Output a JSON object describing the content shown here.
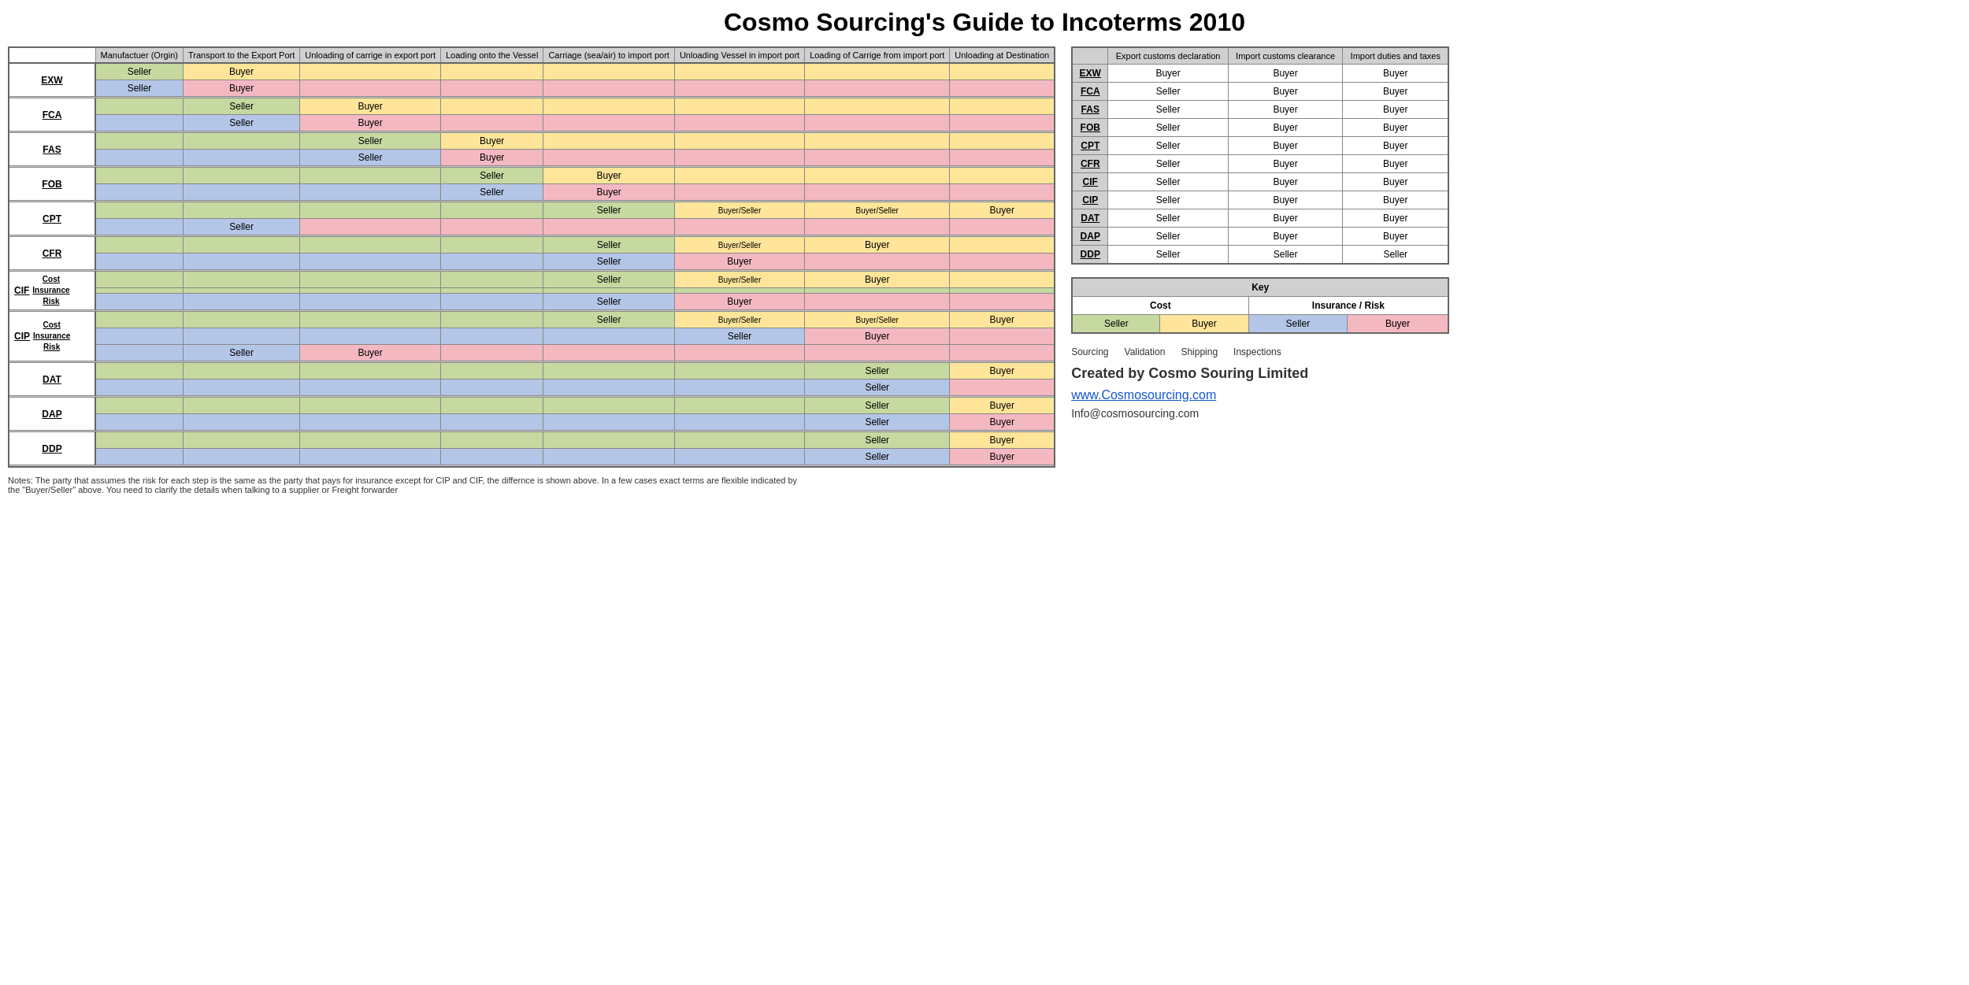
{
  "title": "Cosmo Sourcing's Guide to Incoterms 2010",
  "mainTable": {
    "headers": [
      "",
      "Manufactuer (Orgin)",
      "Transport to the Export Port",
      "Unloading of carrige in export port",
      "Loading onto the Vessel",
      "Carriage (sea/air) to import port",
      "Unloading Vessel in import port",
      "Loading of Carrige from import port",
      "Unloading at Destination"
    ],
    "rows": [
      {
        "term": "EXW",
        "rows": [
          [
            "Seller",
            "Buyer",
            "",
            "",
            "",
            "",
            "",
            ""
          ],
          [
            "Seller",
            "Buyer",
            "",
            "",
            "",
            "",
            "",
            ""
          ]
        ],
        "rowColors": [
          [
            "green-seller",
            "yellow-buyer",
            "yellow-buyer",
            "yellow-buyer",
            "yellow-buyer",
            "yellow-buyer",
            "yellow-buyer",
            "yellow-buyer"
          ],
          [
            "blue-seller",
            "pink-buyer",
            "pink-buyer",
            "pink-buyer",
            "pink-buyer",
            "pink-buyer",
            "pink-buyer",
            "pink-buyer"
          ]
        ]
      },
      {
        "term": "FCA",
        "rows": [
          [
            "",
            "Seller",
            "Buyer",
            "",
            "",
            "",
            "",
            ""
          ],
          [
            "",
            "Seller",
            "Buyer",
            "",
            "",
            "",
            "",
            ""
          ]
        ],
        "rowColors": [
          [
            "green-seller",
            "green-seller",
            "yellow-buyer",
            "yellow-buyer",
            "yellow-buyer",
            "yellow-buyer",
            "yellow-buyer",
            "yellow-buyer"
          ],
          [
            "blue-seller",
            "blue-seller",
            "pink-buyer",
            "pink-buyer",
            "pink-buyer",
            "pink-buyer",
            "pink-buyer",
            "pink-buyer"
          ]
        ]
      },
      {
        "term": "FAS",
        "rows": [
          [
            "",
            "",
            "Seller",
            "Buyer",
            "",
            "",
            "",
            ""
          ],
          [
            "",
            "",
            "Seller",
            "Buyer",
            "",
            "",
            "",
            ""
          ]
        ],
        "rowColors": [
          [
            "green-seller",
            "green-seller",
            "green-seller",
            "yellow-buyer",
            "yellow-buyer",
            "yellow-buyer",
            "yellow-buyer",
            "yellow-buyer"
          ],
          [
            "blue-seller",
            "blue-seller",
            "blue-seller",
            "pink-buyer",
            "pink-buyer",
            "pink-buyer",
            "pink-buyer",
            "pink-buyer"
          ]
        ]
      },
      {
        "term": "FOB",
        "rows": [
          [
            "",
            "",
            "",
            "Seller",
            "Buyer",
            "",
            "",
            ""
          ],
          [
            "",
            "",
            "",
            "Seller",
            "Buyer",
            "",
            "",
            ""
          ]
        ],
        "rowColors": [
          [
            "green-seller",
            "green-seller",
            "green-seller",
            "green-seller",
            "yellow-buyer",
            "yellow-buyer",
            "yellow-buyer",
            "yellow-buyer"
          ],
          [
            "blue-seller",
            "blue-seller",
            "blue-seller",
            "blue-seller",
            "pink-buyer",
            "pink-buyer",
            "pink-buyer",
            "pink-buyer"
          ]
        ]
      },
      {
        "term": "CPT",
        "rows": [
          [
            "",
            "",
            "",
            "",
            "Seller",
            "Buyer/Seller",
            "Buyer/Seller",
            "Buyer"
          ],
          [
            "",
            "Seller",
            "",
            "",
            "",
            "",
            "",
            ""
          ]
        ],
        "rowColors": [
          [
            "green-seller",
            "green-seller",
            "green-seller",
            "green-seller",
            "green-seller",
            "yellow-buyer",
            "yellow-buyer",
            "yellow-buyer"
          ],
          [
            "blue-seller",
            "blue-seller",
            "pink-buyer",
            "pink-buyer",
            "pink-buyer",
            "pink-buyer",
            "pink-buyer",
            "pink-buyer"
          ]
        ]
      },
      {
        "term": "CFR",
        "rows": [
          [
            "",
            "",
            "",
            "",
            "Seller",
            "Buyer/Seller",
            "Buyer",
            ""
          ],
          [
            "",
            "",
            "",
            "",
            "Seller",
            "Buyer",
            "",
            ""
          ]
        ],
        "rowColors": [
          [
            "green-seller",
            "green-seller",
            "green-seller",
            "green-seller",
            "green-seller",
            "yellow-buyer",
            "yellow-buyer",
            "yellow-buyer"
          ],
          [
            "blue-seller",
            "blue-seller",
            "blue-seller",
            "blue-seller",
            "blue-seller",
            "pink-buyer",
            "pink-buyer",
            "pink-buyer"
          ]
        ]
      },
      {
        "term": "CIF",
        "label_rows": [
          "Cost",
          "Insurance",
          "Risk"
        ],
        "rows": [
          [
            "",
            "",
            "",
            "",
            "Seller",
            "Buyer/Seller",
            "Buyer",
            ""
          ],
          [
            "",
            "",
            "",
            "",
            "",
            "",
            "",
            ""
          ],
          [
            "",
            "",
            "",
            "",
            "Seller",
            "Buyer",
            "",
            ""
          ]
        ],
        "rowColors": [
          [
            "green-seller",
            "green-seller",
            "green-seller",
            "green-seller",
            "green-seller",
            "yellow-buyer",
            "yellow-buyer",
            "yellow-buyer"
          ],
          [
            "green-seller",
            "green-seller",
            "green-seller",
            "green-seller",
            "green-seller",
            "green-seller",
            "green-seller",
            "green-seller"
          ],
          [
            "blue-seller",
            "blue-seller",
            "blue-seller",
            "blue-seller",
            "blue-seller",
            "pink-buyer",
            "pink-buyer",
            "pink-buyer"
          ]
        ]
      },
      {
        "term": "CIP",
        "label_rows": [
          "Cost",
          "Insurance",
          "Risk"
        ],
        "rows": [
          [
            "",
            "",
            "",
            "",
            "Seller",
            "Buyer/Seller",
            "Buyer/Seller",
            "Buyer"
          ],
          [
            "",
            "",
            "",
            "",
            "",
            "Seller",
            "Buyer",
            ""
          ],
          [
            "",
            "Seller",
            "Buyer",
            "",
            "",
            "",
            "",
            ""
          ]
        ],
        "rowColors": [
          [
            "green-seller",
            "green-seller",
            "green-seller",
            "green-seller",
            "green-seller",
            "yellow-buyer",
            "yellow-buyer",
            "yellow-buyer"
          ],
          [
            "blue-seller",
            "blue-seller",
            "blue-seller",
            "blue-seller",
            "blue-seller",
            "blue-seller",
            "pink-buyer",
            "pink-buyer"
          ],
          [
            "blue-seller",
            "blue-seller",
            "pink-buyer",
            "pink-buyer",
            "pink-buyer",
            "pink-buyer",
            "pink-buyer",
            "pink-buyer"
          ]
        ]
      },
      {
        "term": "DAT",
        "rows": [
          [
            "",
            "",
            "",
            "",
            "",
            "",
            "Seller",
            "Buyer"
          ],
          [
            "",
            "",
            "",
            "",
            "",
            "",
            "Seller",
            ""
          ]
        ],
        "rowColors": [
          [
            "green-seller",
            "green-seller",
            "green-seller",
            "green-seller",
            "green-seller",
            "green-seller",
            "green-seller",
            "yellow-buyer"
          ],
          [
            "blue-seller",
            "blue-seller",
            "blue-seller",
            "blue-seller",
            "blue-seller",
            "blue-seller",
            "blue-seller",
            "pink-buyer"
          ]
        ]
      },
      {
        "term": "DAP",
        "rows": [
          [
            "",
            "",
            "",
            "",
            "",
            "",
            "Seller",
            "Buyer"
          ],
          [
            "",
            "",
            "",
            "",
            "",
            "",
            "Seller",
            "Buyer"
          ]
        ],
        "rowColors": [
          [
            "green-seller",
            "green-seller",
            "green-seller",
            "green-seller",
            "green-seller",
            "green-seller",
            "green-seller",
            "yellow-buyer"
          ],
          [
            "blue-seller",
            "blue-seller",
            "blue-seller",
            "blue-seller",
            "blue-seller",
            "blue-seller",
            "blue-seller",
            "pink-buyer"
          ]
        ]
      },
      {
        "term": "DDP",
        "rows": [
          [
            "",
            "",
            "",
            "",
            "",
            "",
            "Seller",
            "Buyer"
          ],
          [
            "",
            "",
            "",
            "",
            "",
            "",
            "Seller",
            "Buyer"
          ]
        ],
        "rowColors": [
          [
            "green-seller",
            "green-seller",
            "green-seller",
            "green-seller",
            "green-seller",
            "green-seller",
            "green-seller",
            "yellow-buyer"
          ],
          [
            "blue-seller",
            "blue-seller",
            "blue-seller",
            "blue-seller",
            "blue-seller",
            "blue-seller",
            "blue-seller",
            "pink-buyer"
          ]
        ]
      }
    ]
  },
  "customsTable": {
    "headers": [
      "",
      "Export customs declaration",
      "Import customs clearance",
      "Import duties and taxes"
    ],
    "rows": [
      {
        "term": "EXW",
        "cols": [
          "Buyer",
          "Buyer",
          "Buyer"
        ]
      },
      {
        "term": "FCA",
        "cols": [
          "Seller",
          "Buyer",
          "Buyer"
        ]
      },
      {
        "term": "FAS",
        "cols": [
          "Seller",
          "Buyer",
          "Buyer"
        ]
      },
      {
        "term": "FOB",
        "cols": [
          "Seller",
          "Buyer",
          "Buyer"
        ]
      },
      {
        "term": "CPT",
        "cols": [
          "Seller",
          "Buyer",
          "Buyer"
        ]
      },
      {
        "term": "CFR",
        "cols": [
          "Seller",
          "Buyer",
          "Buyer"
        ]
      },
      {
        "term": "CIF",
        "cols": [
          "Seller",
          "Buyer",
          "Buyer"
        ]
      },
      {
        "term": "CIP",
        "cols": [
          "Seller",
          "Buyer",
          "Buyer"
        ]
      },
      {
        "term": "DAT",
        "cols": [
          "Seller",
          "Buyer",
          "Buyer"
        ]
      },
      {
        "term": "DAP",
        "cols": [
          "Seller",
          "Buyer",
          "Buyer"
        ]
      },
      {
        "term": "DDP",
        "cols": [
          "Seller",
          "Seller",
          "Seller"
        ]
      }
    ]
  },
  "keyTable": {
    "title": "Key",
    "costLabel": "Cost",
    "insuranceLabel": "Insurance / Risk",
    "sellerCost": "Seller",
    "buyerCost": "Buyer",
    "sellerInsurance": "Seller",
    "buyerInsurance": "Buyer"
  },
  "services": [
    "Sourcing",
    "Validation",
    "Shipping",
    "Inspections"
  ],
  "createdBy": "Created by Cosmo Souring Limited",
  "website": "www.Cosmosourcing.com",
  "email": "Info@cosmosourcing.com",
  "notes": "Notes: The party that assumes the risk for each step is the same as the party that pays for insurance except for CIP and CIF, the differnce is shown above.\nIn a few cases exact terms are flexible indicated by the \"Buyer/Seller\" above. You need to clarify the details when talking to a supplier or Freight forwarder"
}
